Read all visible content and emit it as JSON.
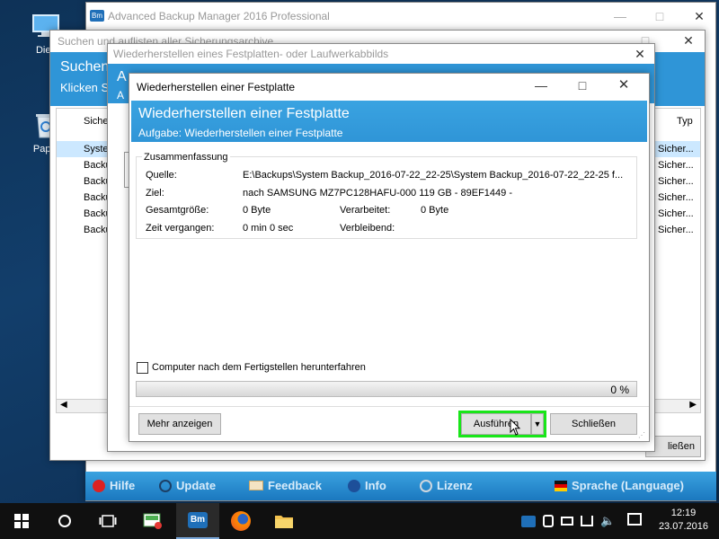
{
  "desktop": {
    "icons": [
      {
        "label": "Dies",
        "name": "this-pc-icon"
      },
      {
        "label": "Papie",
        "name": "recycle-bin-icon"
      }
    ]
  },
  "main_window": {
    "title": "Advanced Backup Manager 2016 Professional",
    "bottom_bar": {
      "help": "Hilfe",
      "update": "Update",
      "feedback": "Feedback",
      "info": "Info",
      "license": "Lizenz",
      "language": "Sprache (Language)"
    }
  },
  "search_window": {
    "title": "Suchen und auflisten aller Sicherungsarchive",
    "header_title": "Suchen",
    "header_sub": "Klicken S",
    "column_left": "Sicher",
    "column_right": "Typ",
    "rows": [
      "Syste",
      "Backu",
      "Backu",
      "Backu",
      "Backu",
      "Backu"
    ],
    "types": [
      "Sicher...",
      "Sicher...",
      "Sicher...",
      "Sicher...",
      "Sicher...",
      "Sicher..."
    ],
    "close_label": "ließen"
  },
  "restore_image_window": {
    "title": "Wiederherstellen eines Festplatten- oder Laufwerkabbilds",
    "header_a1": "A",
    "header_a2": "A"
  },
  "dialog": {
    "title": "Wiederherstellen einer Festplatte",
    "header_title": "Wiederherstellen einer Festplatte",
    "header_task": "Aufgabe: Wiederherstellen einer Festplatte",
    "summary_legend": "Zusammenfassung",
    "source_label": "Quelle:",
    "source_value": "E:\\Backups\\System Backup_2016-07-22_22-25\\System Backup_2016-07-22_22-25  f...",
    "target_label": "Ziel:",
    "target_value": "nach    SAMSUNG MZ7PC128HAFU-000 119 GB - 89EF1449 -",
    "total_label": "Gesamtgröße:",
    "total_value": "0 Byte",
    "processed_label": "Verarbeitet:",
    "processed_value": "0 Byte",
    "elapsed_label": "Zeit vergangen:",
    "elapsed_value": "0 min  0 sec",
    "remaining_label": "Verbleibend:",
    "remaining_value": "",
    "shutdown_label": "Computer nach dem Fertigstellen herunterfahren",
    "progress_text": "0 %",
    "progress_fraction": 0,
    "more_button": "Mehr anzeigen",
    "execute_button": "Ausführen",
    "close_button": "Schließen"
  },
  "taskbar": {
    "time": "12:19",
    "date": "23.07.2016",
    "bm_label": "Bm"
  },
  "colors": {
    "accent_blue": "#2f95d7",
    "highlight_green": "#19e619",
    "taskbar_bg": "#101010"
  }
}
